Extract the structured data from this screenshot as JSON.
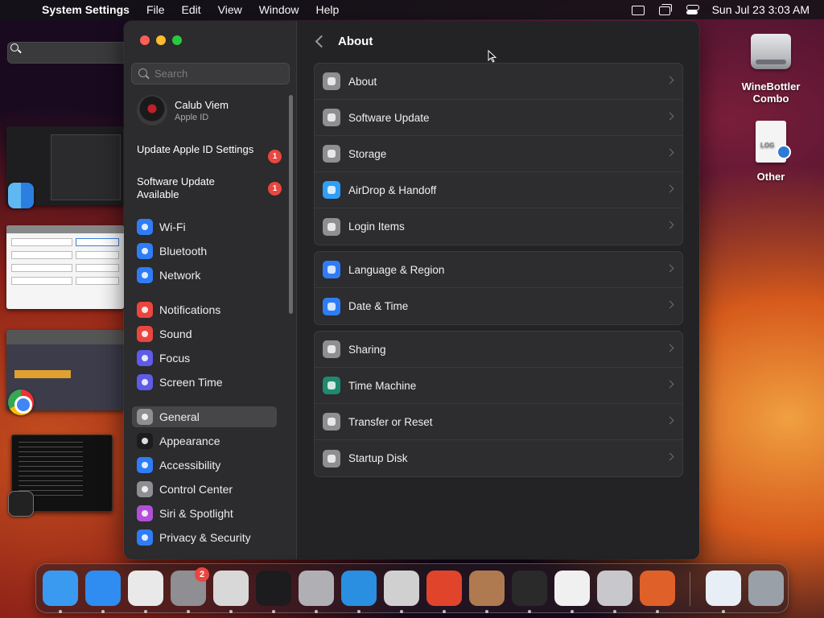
{
  "menubar": {
    "app_name": "System Settings",
    "menus": [
      "File",
      "Edit",
      "View",
      "Window",
      "Help"
    ],
    "clock": "Sun Jul 23  3:03 AM"
  },
  "desktop": {
    "icons": [
      {
        "label": "WineBottler Combo"
      },
      {
        "label": "Other"
      }
    ]
  },
  "sidebar": {
    "search_placeholder": "Search",
    "account": {
      "name": "Calub Viem",
      "sub": "Apple ID"
    },
    "notices": [
      {
        "label": "Update Apple ID Settings",
        "badge": "1"
      },
      {
        "label": "Software Update Available",
        "badge": "1"
      }
    ],
    "items": [
      {
        "label": "Wi-Fi",
        "icon": "wifi-icon",
        "color": "#2f7df6"
      },
      {
        "label": "Bluetooth",
        "icon": "bluetooth-icon",
        "color": "#2f7df6"
      },
      {
        "label": "Network",
        "icon": "globe-icon",
        "color": "#2f7df6"
      },
      {
        "label": "Notifications",
        "icon": "bell-icon",
        "color": "#e9463f"
      },
      {
        "label": "Sound",
        "icon": "speaker-icon",
        "color": "#e9463f"
      },
      {
        "label": "Focus",
        "icon": "moon-icon",
        "color": "#5e5ce6"
      },
      {
        "label": "Screen Time",
        "icon": "hourglass-icon",
        "color": "#5e5ce6"
      },
      {
        "label": "General",
        "icon": "gear-icon",
        "color": "#8e8e93"
      },
      {
        "label": "Appearance",
        "icon": "appearance-icon",
        "color": "#1c1c1e"
      },
      {
        "label": "Accessibility",
        "icon": "accessibility-icon",
        "color": "#2f7df6"
      },
      {
        "label": "Control Center",
        "icon": "control-center-icon",
        "color": "#8e8e93"
      },
      {
        "label": "Siri & Spotlight",
        "icon": "siri-icon",
        "color": "#b14fd8"
      },
      {
        "label": "Privacy & Security",
        "icon": "hand-icon",
        "color": "#2f7df6"
      }
    ]
  },
  "main": {
    "title": "About",
    "groups": [
      [
        {
          "label": "About",
          "icon": "computer-icon",
          "color": "#8e8e93"
        },
        {
          "label": "Software Update",
          "icon": "gear-update-icon",
          "color": "#8e8e93"
        },
        {
          "label": "Storage",
          "icon": "storage-icon",
          "color": "#8e8e93"
        },
        {
          "label": "AirDrop & Handoff",
          "icon": "airdrop-icon",
          "color": "#2f9ef6"
        },
        {
          "label": "Login Items",
          "icon": "list-icon",
          "color": "#8e8e93"
        }
      ],
      [
        {
          "label": "Language & Region",
          "icon": "globe-icon",
          "color": "#2f7df6"
        },
        {
          "label": "Date & Time",
          "icon": "calendar-icon",
          "color": "#2f7df6"
        }
      ],
      [
        {
          "label": "Sharing",
          "icon": "sharing-icon",
          "color": "#8e8e93"
        },
        {
          "label": "Time Machine",
          "icon": "time-machine-icon",
          "color": "#1f8a70"
        },
        {
          "label": "Transfer or Reset",
          "icon": "reset-icon",
          "color": "#8e8e93"
        },
        {
          "label": "Startup Disk",
          "icon": "disk-icon",
          "color": "#8e8e93"
        }
      ]
    ]
  },
  "dock": {
    "apps": [
      {
        "icon": "finder-icon",
        "color": "#3a9af0"
      },
      {
        "icon": "safari-icon",
        "color": "#2f8cf0"
      },
      {
        "icon": "chrome-icon",
        "color": "#e9e9e9"
      },
      {
        "icon": "system-settings-icon",
        "color": "#8e8e93",
        "badge": "2"
      },
      {
        "icon": "script-editor-icon",
        "color": "#d8d8d8"
      },
      {
        "icon": "terminal-icon",
        "color": "#1c1c1e"
      },
      {
        "icon": "compressor-pro-icon",
        "color": "#b0b0b4"
      },
      {
        "icon": "vscode-icon",
        "color": "#2a8fe0"
      },
      {
        "icon": "launchpad-icon",
        "color": "#d0d0d0"
      },
      {
        "icon": "remote-desktop-icon",
        "color": "#e0452c"
      },
      {
        "icon": "box-app-icon",
        "color": "#b07a50"
      },
      {
        "icon": "console-icon",
        "color": "#2a2a2a"
      },
      {
        "icon": "hexagon-app-icon",
        "color": "#f0f0f0"
      },
      {
        "icon": "gears-app-icon",
        "color": "#c8c8cc"
      },
      {
        "icon": "firefox-icon",
        "color": "#e0602a"
      },
      {
        "icon": "downloads-icon",
        "color": "#e8eef6"
      },
      {
        "icon": "trash-icon",
        "color": "#9aa0a8"
      }
    ]
  }
}
